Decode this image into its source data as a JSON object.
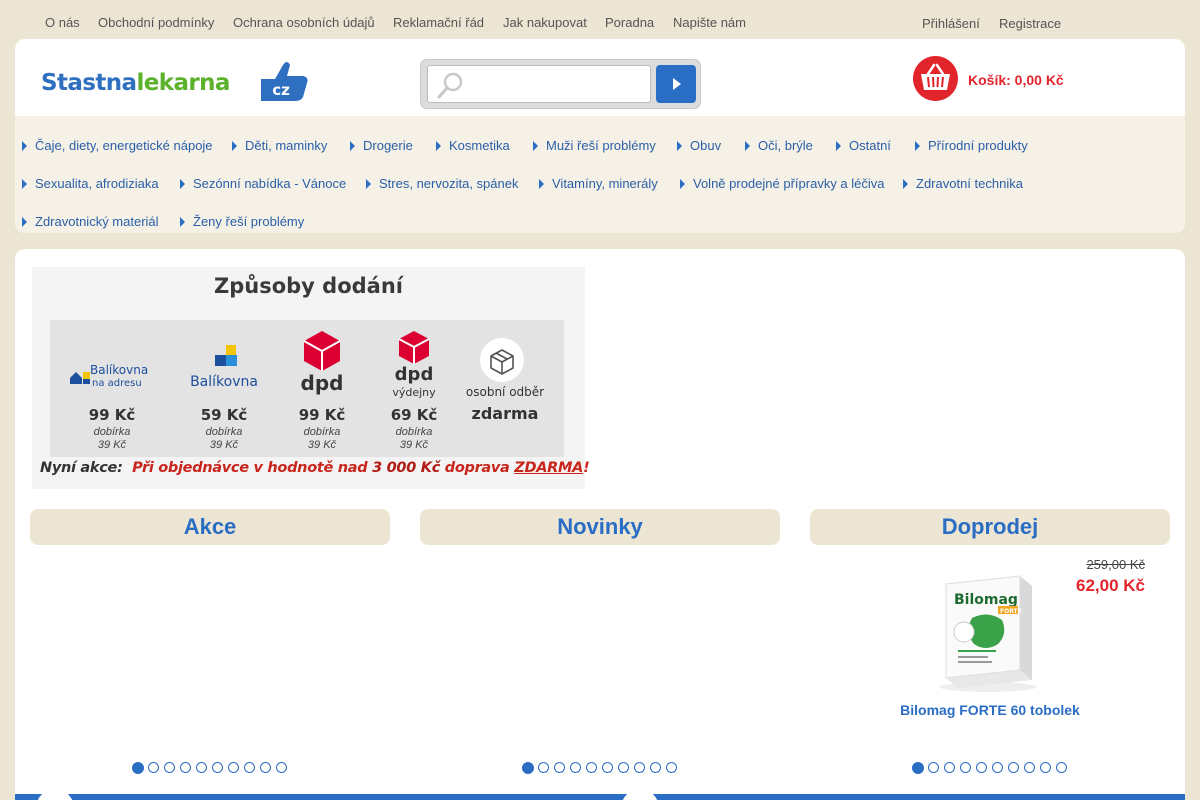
{
  "toplinks": [
    "O nás",
    "Obchodní podmínky",
    "Ochrana osobních údajů",
    "Reklamační řád",
    "Jak nakupovat",
    "Poradna",
    "Napište nám"
  ],
  "account": {
    "login": "Přihlášení",
    "register": "Registrace"
  },
  "logo": {
    "part1": "Stastna",
    "part2": "lekarna",
    "part3": "cz"
  },
  "search": {
    "value": "",
    "placeholder": ""
  },
  "cart": {
    "label": "Košík: 0,00 Kč"
  },
  "categories": [
    "Čaje, diety, energetické nápoje",
    "Děti, maminky",
    "Drogerie",
    "Kosmetika",
    "Muži řeší problémy",
    "Obuv",
    "Oči, brýle",
    "Ostatní",
    "Přírodní produkty",
    "Sexualita, afrodiziaka",
    "Sezónní nabídka - Vánoce",
    "Stres, nervozita, spánek",
    "Vitamíny, minerály",
    "Volně prodejné přípravky a léčiva",
    "Zdravotní technika",
    "Zdravotnický materiál",
    "Ženy řeší problémy"
  ],
  "banner": {
    "title": "Způsoby dodání",
    "carriers": [
      {
        "name1": "Balíkovna",
        "name2": "na adresu",
        "price": "99 Kč",
        "note1": "dobírka",
        "note2": "39 Kč"
      },
      {
        "name1": "Balíkovna",
        "price": "59 Kč",
        "note1": "dobírka",
        "note2": "39 Kč"
      },
      {
        "name1": "dpd",
        "price": "99 Kč",
        "note1": "dobírka",
        "note2": "39 Kč"
      },
      {
        "name1": "dpd",
        "name2": "výdejny",
        "price": "69 Kč",
        "note1": "dobírka",
        "note2": "39 Kč"
      },
      {
        "name1": "osobní odběr",
        "price": "zdarma"
      }
    ],
    "promo_lead": "Nyní akce:",
    "promo_text": "Při objednávce v hodnotě nad",
    "promo_amount": "3 000 Kč",
    "promo_text2": "doprava",
    "promo_free": "ZDARMA",
    "promo_end": "!"
  },
  "sections": {
    "sale": "Akce",
    "new": "Novinky",
    "clearance": "Doprodej"
  },
  "product": {
    "old_price": "259,00 Kč",
    "new_price": "62,00 Kč",
    "name": "Bilomag FORTE 60 tobolek",
    "box_brand": "Bilomag",
    "box_badge": "FORTE"
  },
  "carousel": {
    "pages": 10,
    "active": 1
  },
  "colors": {
    "accent": "#2a6dc4",
    "red": "#e2242b",
    "background": "#ece5d3",
    "green": "#5cb22b"
  }
}
